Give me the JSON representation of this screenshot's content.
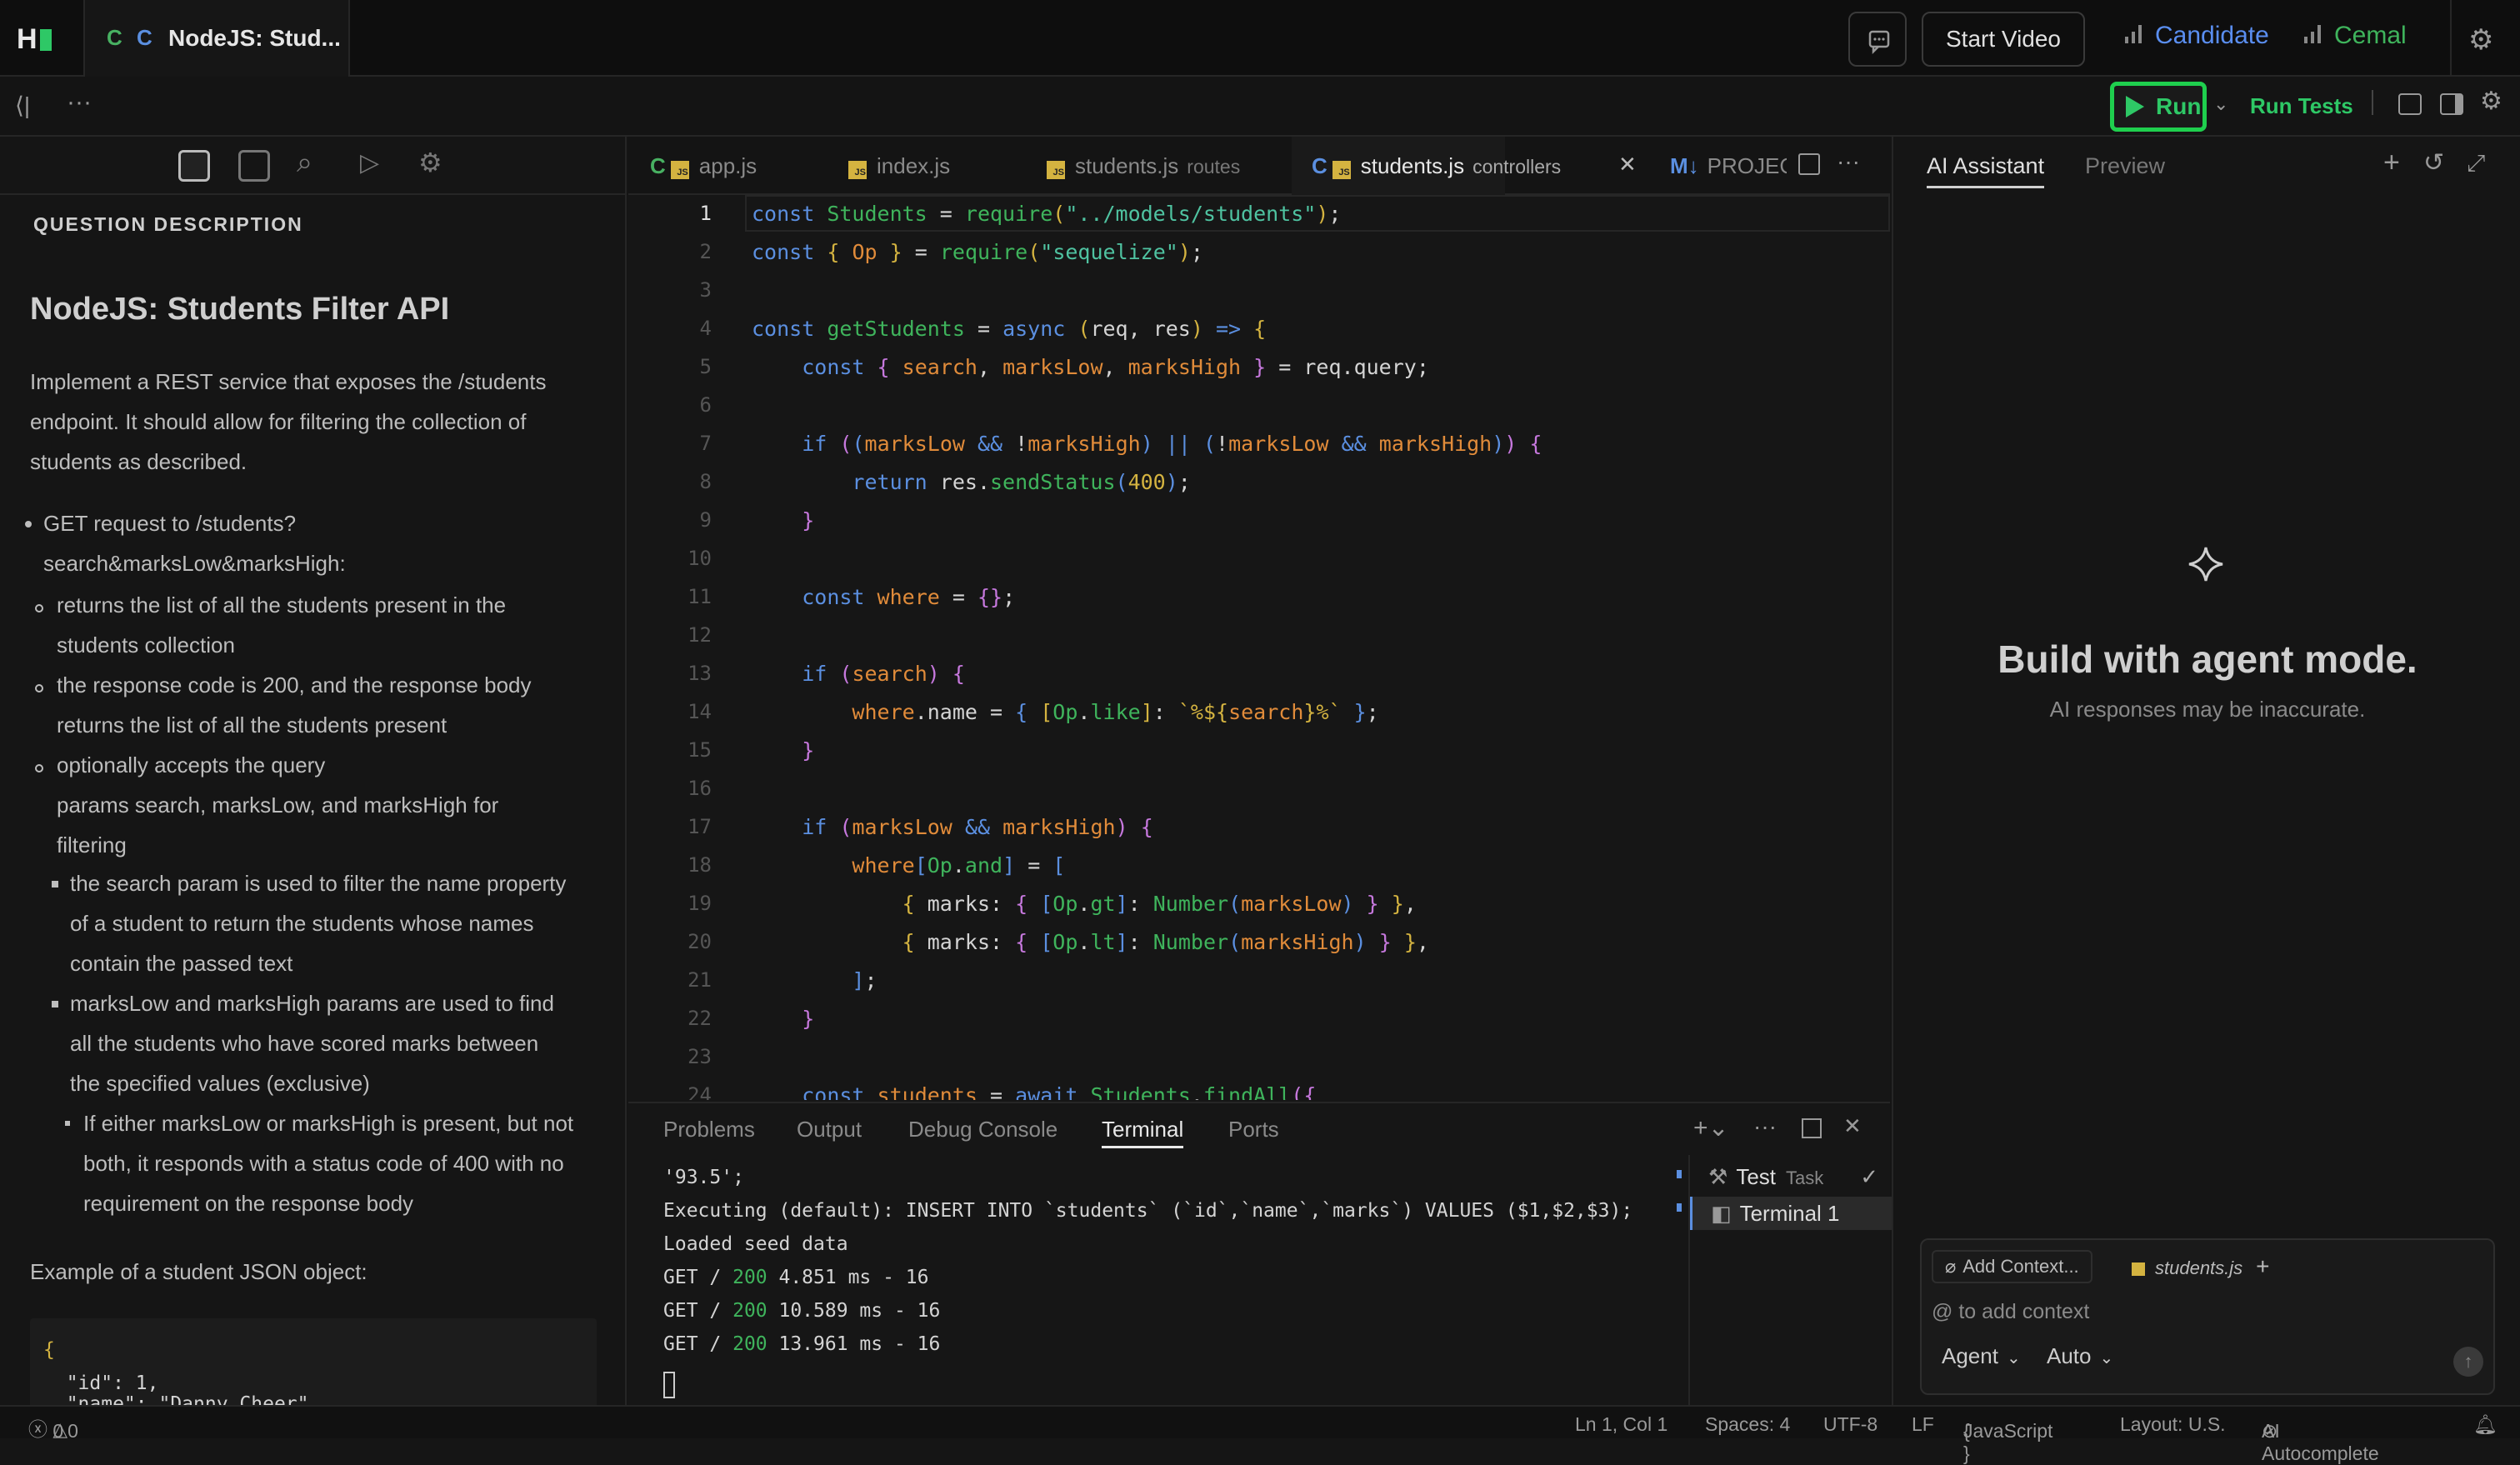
{
  "app": {
    "logo": "H",
    "tab_title": "NodeJS: Stud...",
    "tab_icon_1": "C",
    "tab_icon_2": "C"
  },
  "header": {
    "start_video": "Start Video",
    "candidate": "Candidate",
    "cemal": "Cemal"
  },
  "toolbar": {
    "run": "Run",
    "run_tests": "Run Tests"
  },
  "question": {
    "section_label": "QUESTION DESCRIPTION",
    "title": "NodeJS: Students Filter API",
    "intro": [
      "Implement a REST service that exposes the /students",
      "endpoint. It should allow for filtering the collection of",
      "students as described."
    ],
    "b1": [
      "GET request to /students?",
      "search&marksLow&marksHigh:"
    ],
    "b1a": [
      "returns the list of all the students present in the",
      "students collection"
    ],
    "b1b": [
      "the response code is 200, and the response body",
      "returns the list of all the students present"
    ],
    "b1c": [
      "optionally accepts the query",
      "params search, marksLow, and marksHigh for",
      "filtering"
    ],
    "b1c1": [
      "the search param is used to filter the name property",
      "of a student to return the students whose names",
      "contain the passed text"
    ],
    "b1c2": [
      "marksLow and marksHigh params are used to find",
      "all the students who have scored marks between",
      "the specified values (exclusive)"
    ],
    "b1c2a": [
      "If either marksLow or marksHigh is present, but not",
      "both, it responds with a status code of 400 with no",
      "requirement on the response body"
    ],
    "example_label": "Example of a student JSON object:",
    "example_code": [
      "{",
      "  \"id\": 1,",
      "  \"name\": \"Danny Cheer\","
    ]
  },
  "editor_tabs": [
    {
      "name": "app.js",
      "sub": ""
    },
    {
      "name": "index.js",
      "sub": ""
    },
    {
      "name": "students.js",
      "sub": "routes"
    },
    {
      "name": "students.js",
      "sub": "controllers"
    },
    {
      "name": "PROJEC",
      "sub": ""
    }
  ],
  "code": {
    "current_line": "1",
    "line_numbers": [
      "1",
      "2",
      "3",
      "4",
      "5",
      "6",
      "7",
      "8",
      "9",
      "10",
      "11",
      "12",
      "13",
      "14",
      "15",
      "16",
      "17",
      "18",
      "19",
      "20",
      "21",
      "22",
      "23",
      "24"
    ]
  },
  "terminal": {
    "tabs": [
      "Problems",
      "Output",
      "Debug Console",
      "Terminal",
      "Ports"
    ],
    "lines": [
      "'93.5';",
      "Executing (default): INSERT INTO `students` (`id`,`name`,`marks`) VALUES ($1,$2,$3);",
      "Loaded seed data"
    ],
    "requests": [
      {
        "prefix": "GET / ",
        "code": "200",
        "rest": " 4.851 ms - 16"
      },
      {
        "prefix": "GET / ",
        "code": "200",
        "rest": " 10.589 ms - 16"
      },
      {
        "prefix": "GET / ",
        "code": "200",
        "rest": " 13.961 ms - 16"
      }
    ],
    "side_items": [
      {
        "label": "Test",
        "sub": "Task"
      },
      {
        "label": "Terminal 1"
      }
    ]
  },
  "assistant": {
    "tab_ai": "AI Assistant",
    "tab_preview": "Preview",
    "heading": "Build with agent mode.",
    "subheading": "AI responses may be inaccurate.",
    "add_context": "Add Context...",
    "context_file": "students.js",
    "input_placeholder": "@ to add context",
    "mode": "Agent",
    "model": "Auto"
  },
  "status": {
    "errors": "0",
    "warnings": "0",
    "position": "Ln 1, Col 1",
    "spaces": "Spaces: 4",
    "encoding": "UTF-8",
    "eol": "LF",
    "language": "JavaScript",
    "layout": "Layout: U.S.",
    "autocomplete": "AI Autocomplete"
  },
  "colors": {
    "accent_green": "#2ec866",
    "accent_blue": "#5a8ef0",
    "background": "#151515"
  }
}
